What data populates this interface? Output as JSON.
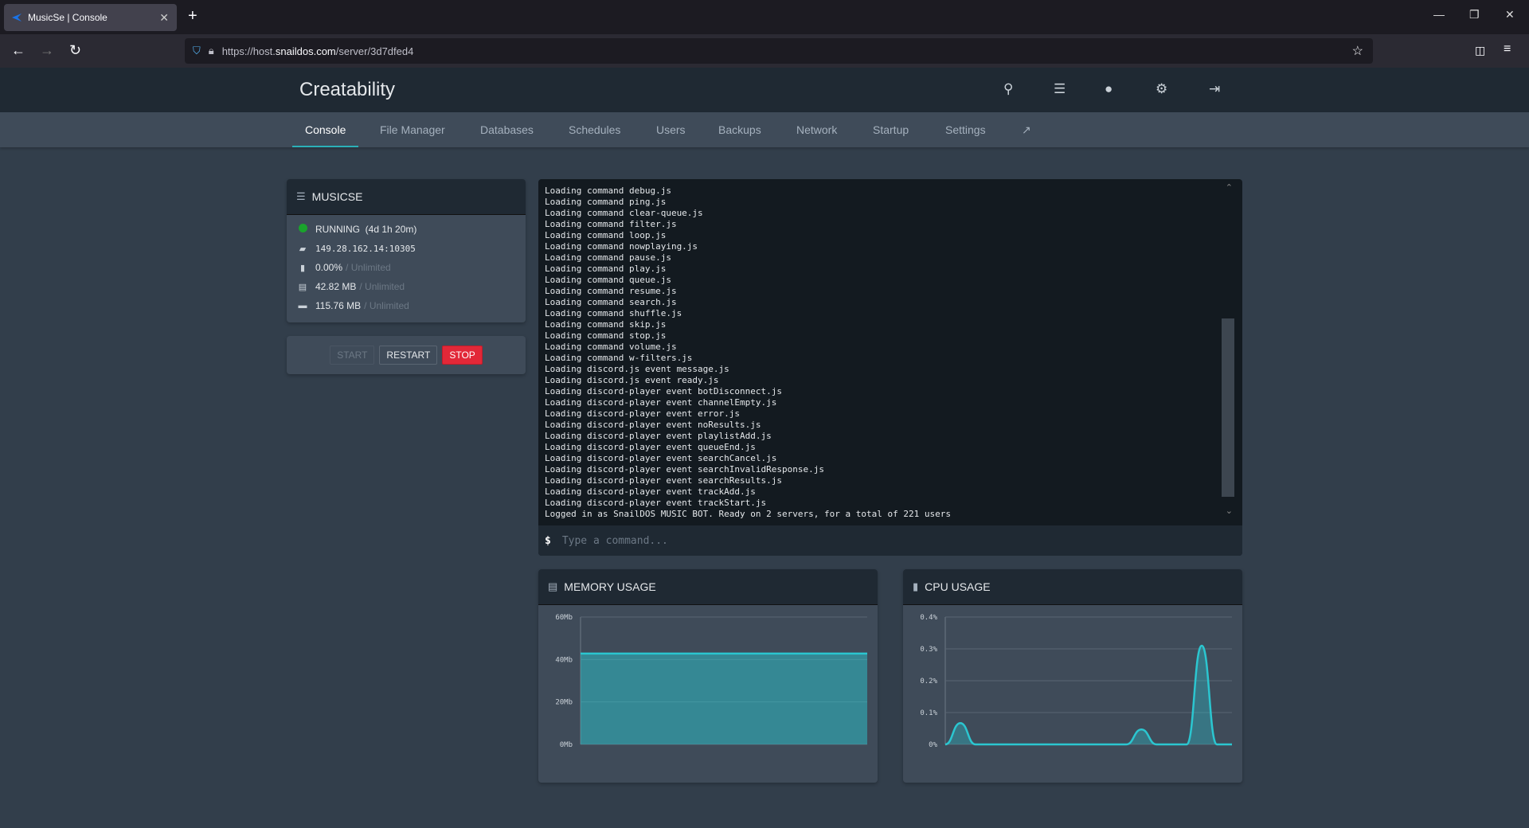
{
  "browser": {
    "tab_title": "MusicSe | Console",
    "url_prefix": "https://host.",
    "url_host": "snaildos.com",
    "url_path": "/server/3d7dfed4"
  },
  "header": {
    "title": "Creatability"
  },
  "nav": {
    "items": [
      "Console",
      "File Manager",
      "Databases",
      "Schedules",
      "Users",
      "Backups",
      "Network",
      "Startup",
      "Settings"
    ],
    "active": "Console"
  },
  "server": {
    "name": "MUSICSE",
    "status": "RUNNING",
    "uptime": "(4d 1h 20m)",
    "status_color": "#1aa32c",
    "address": "149.28.162.14:10305",
    "cpu": "0.00%",
    "cpu_limit": "/ Unlimited",
    "memory": "42.82 MB",
    "memory_limit": "/ Unlimited",
    "disk": "115.76 MB",
    "disk_limit": "/ Unlimited"
  },
  "power": {
    "start": "START",
    "restart": "RESTART",
    "stop": "STOP"
  },
  "console": {
    "lines": [
      "Loading command debug.js",
      "Loading command ping.js",
      "Loading command clear-queue.js",
      "Loading command filter.js",
      "Loading command loop.js",
      "Loading command nowplaying.js",
      "Loading command pause.js",
      "Loading command play.js",
      "Loading command queue.js",
      "Loading command resume.js",
      "Loading command search.js",
      "Loading command shuffle.js",
      "Loading command skip.js",
      "Loading command stop.js",
      "Loading command volume.js",
      "Loading command w-filters.js",
      "Loading discord.js event message.js",
      "Loading discord.js event ready.js",
      "Loading discord-player event botDisconnect.js",
      "Loading discord-player event channelEmpty.js",
      "Loading discord-player event error.js",
      "Loading discord-player event noResults.js",
      "Loading discord-player event playlistAdd.js",
      "Loading discord-player event queueEnd.js",
      "Loading discord-player event searchCancel.js",
      "Loading discord-player event searchInvalidResponse.js",
      "Loading discord-player event searchResults.js",
      "Loading discord-player event trackAdd.js",
      "Loading discord-player event trackStart.js",
      "Logged in as SnailDOS MUSIC BOT. Ready on 2 servers, for a total of 221 users"
    ],
    "prompt": "$",
    "placeholder": "Type a command..."
  },
  "chart_data": [
    {
      "type": "area",
      "title": "MEMORY USAGE",
      "ylim": [
        0,
        60
      ],
      "yticks": [
        "0Mb",
        "20Mb",
        "40Mb",
        "60Mb"
      ],
      "ytick_values": [
        0,
        20,
        40,
        60
      ],
      "values": [
        42.82,
        42.82,
        42.82,
        42.82,
        42.82,
        42.82,
        42.82,
        42.82,
        42.82,
        42.82,
        42.82,
        42.82,
        42.82,
        42.82,
        42.82,
        42.82,
        42.82,
        42.82,
        42.82,
        42.82
      ],
      "color": "#2bc6d0",
      "grid": true
    },
    {
      "type": "area",
      "title": "CPU USAGE",
      "ylim": [
        0,
        0.4
      ],
      "yticks": [
        "0%",
        "0.1%",
        "0.2%",
        "0.3%",
        "0.4%"
      ],
      "ytick_values": [
        0,
        0.1,
        0.2,
        0.3,
        0.4
      ],
      "values": [
        0,
        0.067,
        0,
        0,
        0,
        0,
        0,
        0,
        0,
        0,
        0,
        0,
        0,
        0.047,
        0,
        0,
        0,
        0.31,
        0,
        0
      ],
      "color": "#2bc6d0",
      "grid": true
    }
  ]
}
